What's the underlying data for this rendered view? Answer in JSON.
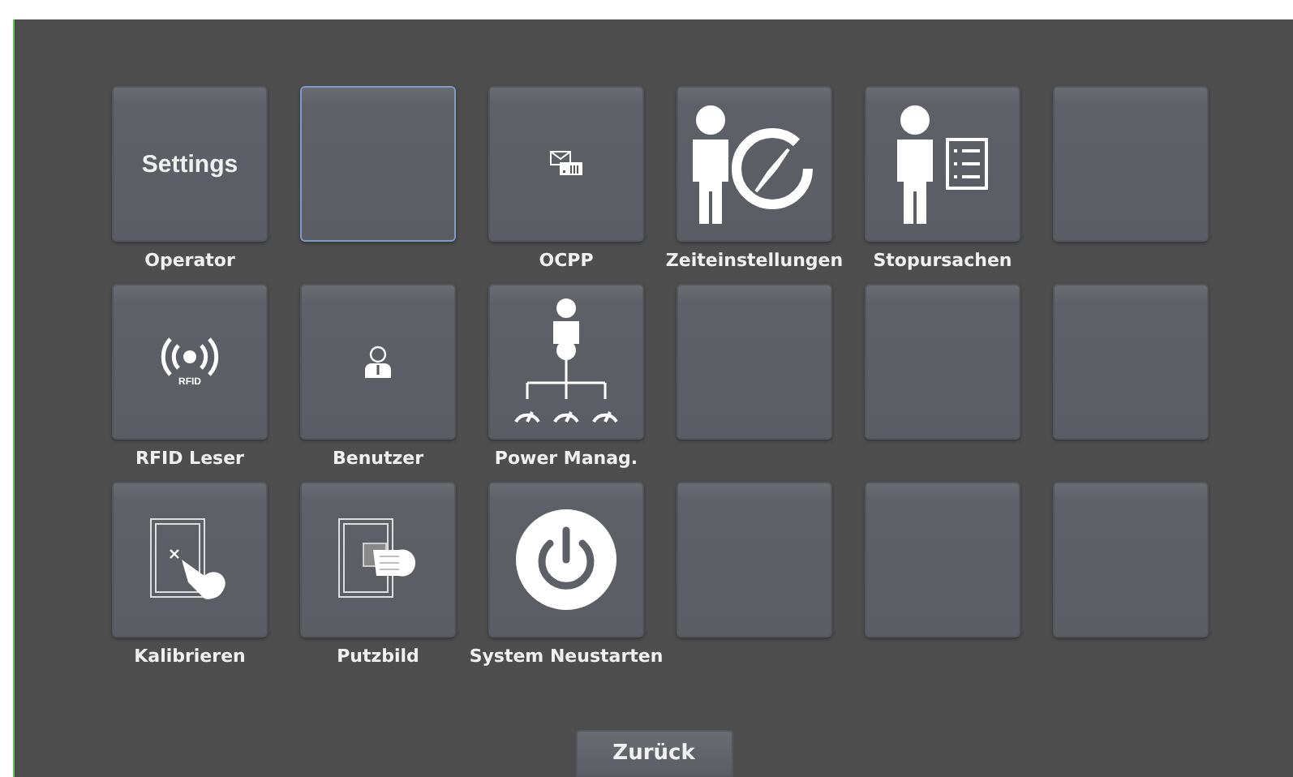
{
  "tiles": [
    {
      "kind": "text",
      "text": "Settings",
      "label": "Operator",
      "selected": false
    },
    {
      "kind": "empty",
      "selected": true
    },
    {
      "kind": "icon",
      "label": "OCPP",
      "selected": false
    },
    {
      "kind": "icon",
      "label": "Zeiteinstellungen",
      "selected": false
    },
    {
      "kind": "icon",
      "label": "Stopursachen",
      "selected": false
    },
    {
      "kind": "empty",
      "selected": false
    },
    {
      "kind": "icon",
      "icon_text": "RFID",
      "label": "RFID Leser",
      "selected": false
    },
    {
      "kind": "icon",
      "label": "Benutzer",
      "selected": false
    },
    {
      "kind": "icon",
      "label": "Power Manag.",
      "selected": false
    },
    {
      "kind": "empty",
      "selected": false
    },
    {
      "kind": "empty",
      "selected": false
    },
    {
      "kind": "empty",
      "selected": false
    },
    {
      "kind": "icon",
      "label": "Kalibrieren",
      "selected": false
    },
    {
      "kind": "icon",
      "label": "Putzbild",
      "selected": false
    },
    {
      "kind": "icon",
      "label": "System Neustarten",
      "selected": false
    },
    {
      "kind": "empty",
      "selected": false
    },
    {
      "kind": "empty",
      "selected": false
    },
    {
      "kind": "empty",
      "selected": false
    }
  ],
  "back_button": "Zurück"
}
